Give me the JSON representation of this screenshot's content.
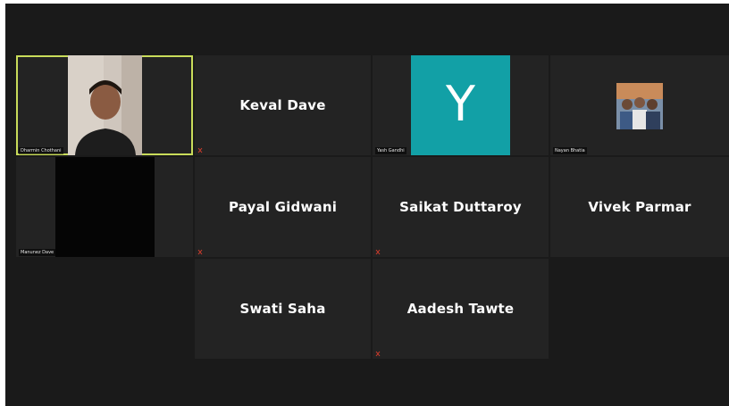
{
  "participants": {
    "dharmin": {
      "label": "Dharmin Chothani"
    },
    "keval": {
      "display_name": "Keval Dave"
    },
    "yash": {
      "avatar_letter": "Y",
      "label": "Yash Gandhi"
    },
    "nayan": {
      "label": "Nayan Bhatia"
    },
    "manunez": {
      "label": "Manunez Dave"
    },
    "payal": {
      "display_name": "Payal Gidwani"
    },
    "saikat": {
      "display_name": "Saikat Duttaroy"
    },
    "vivek": {
      "display_name": "Vivek Parmar"
    },
    "swati": {
      "display_name": "Swati Saha"
    },
    "aadesh": {
      "display_name": "Aadesh Tawte"
    }
  },
  "colors": {
    "background": "#1a1a1a",
    "tile": "#232323",
    "active_speaker_border": "#c9dc5a",
    "avatar_teal": "#12a0a6",
    "muted_icon": "#d23c2c"
  }
}
